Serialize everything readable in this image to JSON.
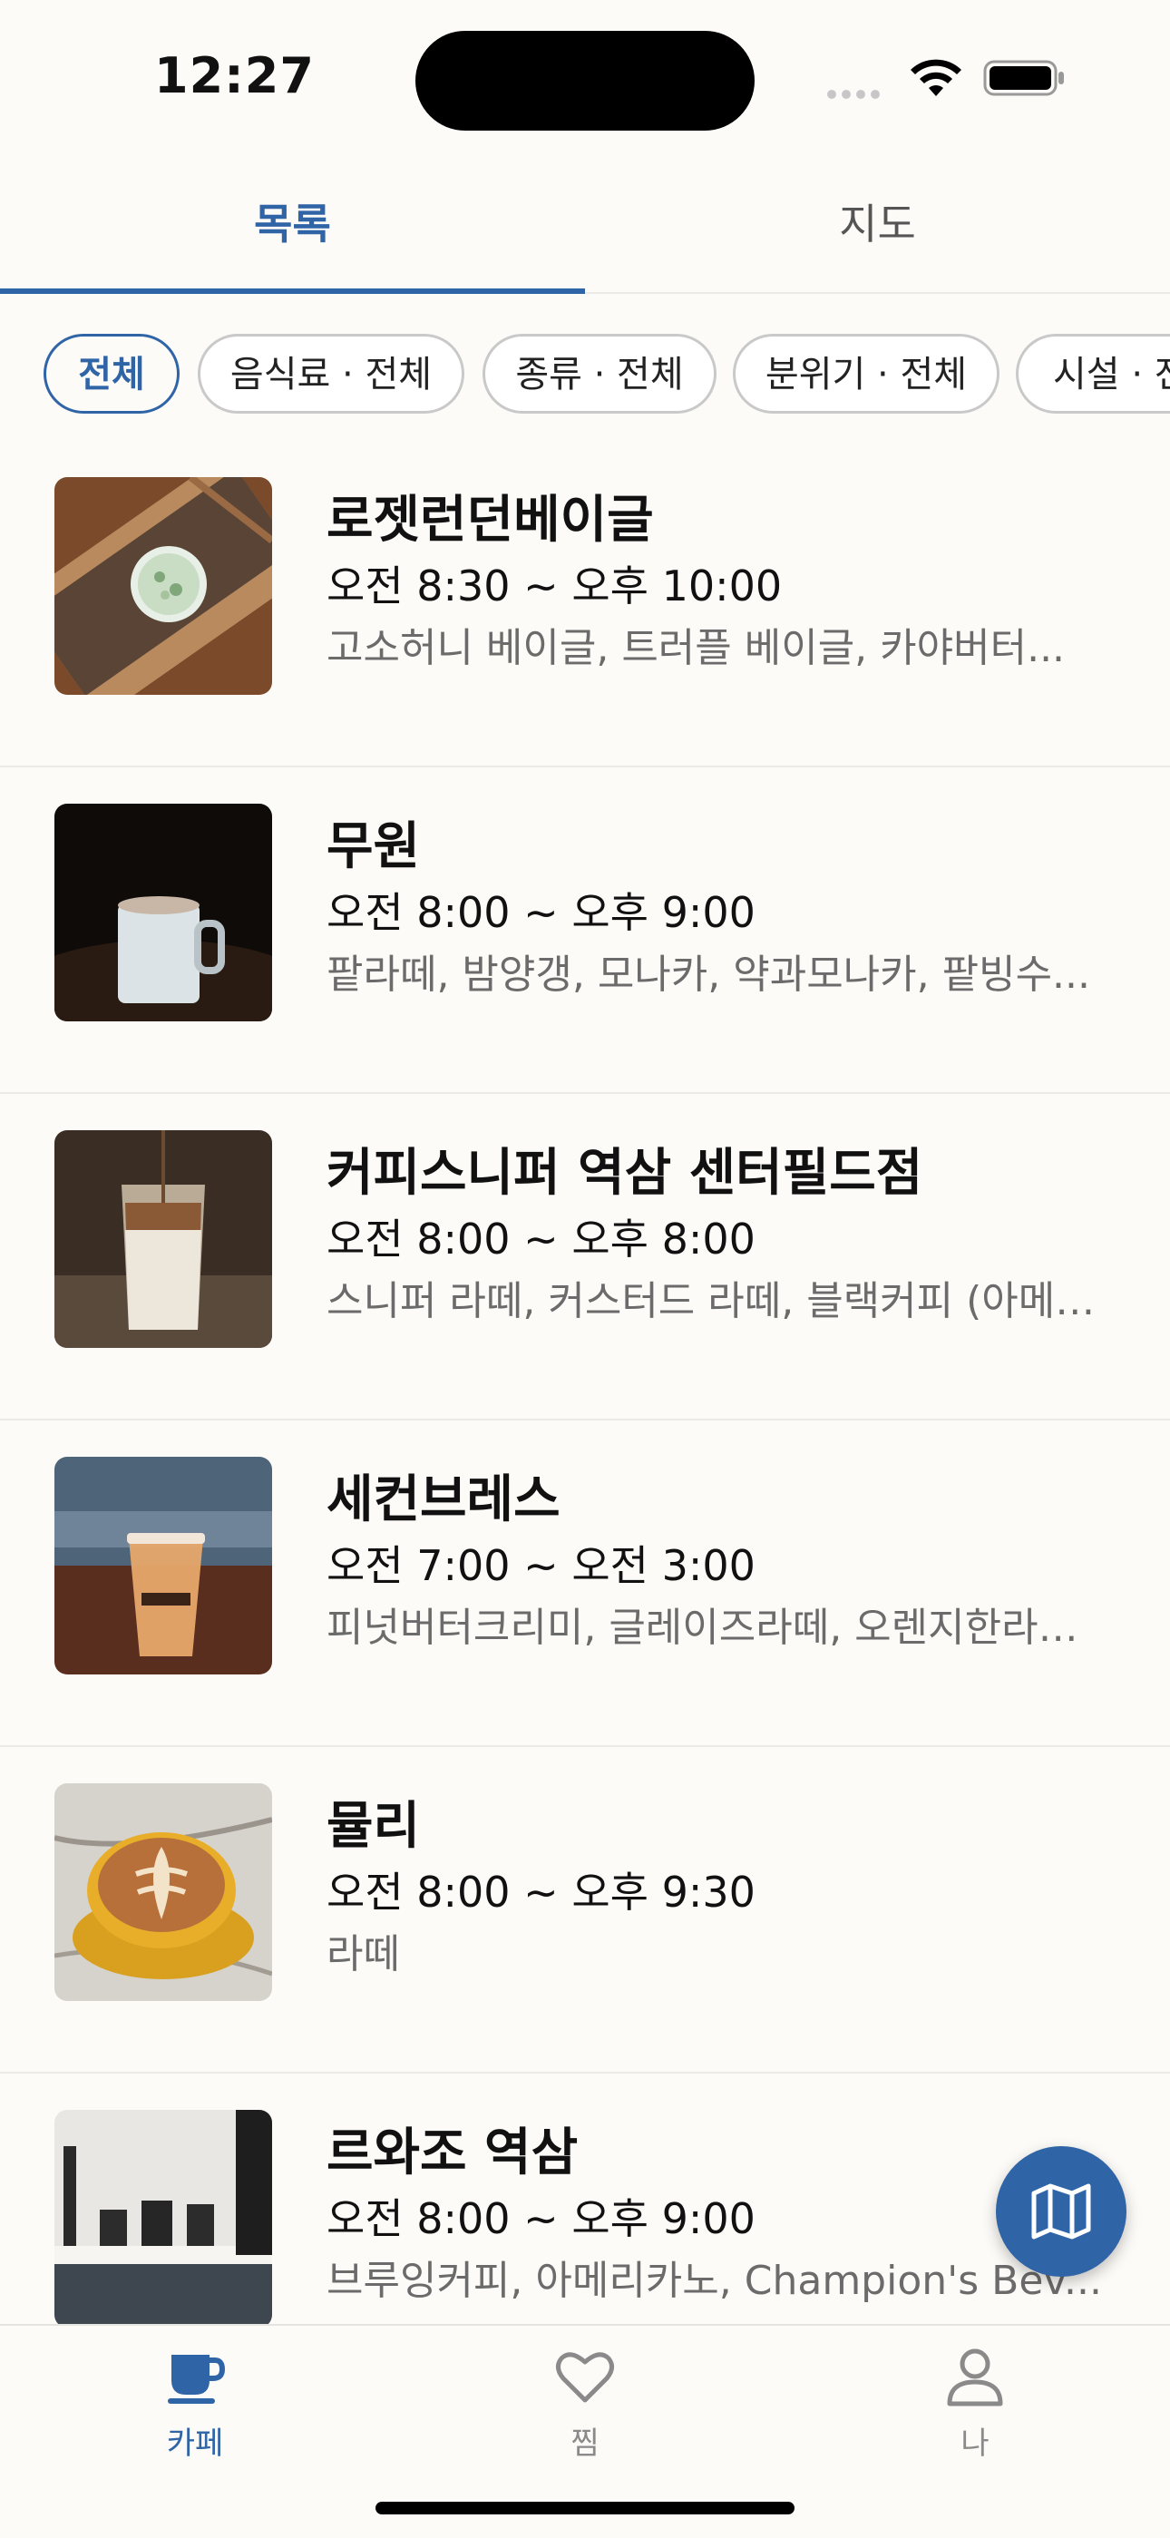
{
  "status_bar": {
    "time": "12:27"
  },
  "top_tabs": [
    {
      "label": "목록",
      "active": true
    },
    {
      "label": "지도",
      "active": false
    }
  ],
  "filters": [
    {
      "label": "전체",
      "active": true
    },
    {
      "label": "음식료 · 전체",
      "active": false
    },
    {
      "label": "종류 · 전체",
      "active": false
    },
    {
      "label": "분위기 · 전체",
      "active": false
    },
    {
      "label": "시설 · 전체",
      "active": false
    }
  ],
  "cafes": [
    {
      "name": "로젯런던베이글",
      "hours": "오전 8:30 ~ 오후 10:00",
      "menu": "고소허니 베이글, 트러플 베이글, 카야버터...",
      "photo": "bagel-plate"
    },
    {
      "name": "무원",
      "hours": "오전 8:00 ~ 오후 9:00",
      "menu": "팥라떼, 밤양갱, 모나카, 약과모나카, 팥빙수...",
      "photo": "white-mug"
    },
    {
      "name": "커피스니퍼 역삼 센터필드점",
      "hours": "오전 8:00 ~ 오후 8:00",
      "menu": "스니퍼 라떼, 커스터드 라떼, 블랙커피 (아메…",
      "photo": "iced-latte"
    },
    {
      "name": "세컨브레스",
      "hours": "오전 7:00 ~ 오전 3:00",
      "menu": "피넛버터크리미, 글레이즈라떼, 오렌지한라…",
      "photo": "takeout-cup"
    },
    {
      "name": "뮬리",
      "hours": "오전 8:00 ~ 오후 9:30",
      "menu": "라떼",
      "photo": "latte-art"
    },
    {
      "name": "르와조 역삼",
      "hours": "오전 8:00 ~ 오후 9:00",
      "menu": "브루잉커피, 아메리카노, Champion's Bev...",
      "photo": "coffee-bar"
    }
  ],
  "bottom_nav": [
    {
      "label": "카페",
      "icon": "coffee-cup-icon",
      "active": true
    },
    {
      "label": "찜",
      "icon": "heart-icon",
      "active": false
    },
    {
      "label": "나",
      "icon": "person-icon",
      "active": false
    }
  ],
  "colors": {
    "accent": "#2F64A6",
    "background": "#FCFBF8",
    "secondary_text": "#6B6B6B"
  }
}
